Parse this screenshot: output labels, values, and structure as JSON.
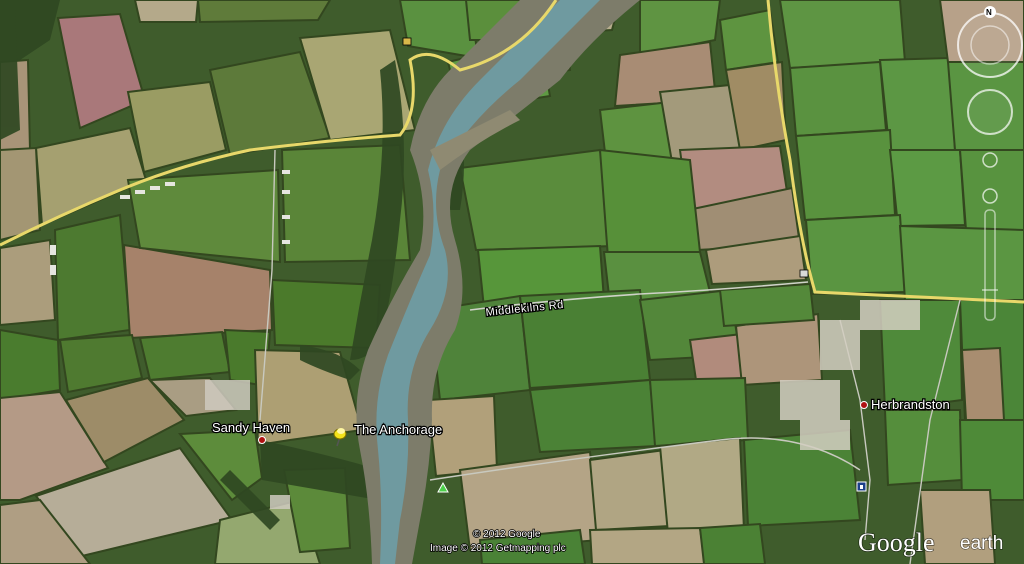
{
  "places": {
    "sandy_haven": "Sandy Haven",
    "the_anchorage": "The Anchorage",
    "herbrandston": "Herbrandston"
  },
  "roads": {
    "middle_rd": "Middlekilns Rd"
  },
  "credits": {
    "line1": "© 2012 Google",
    "line2": "Image © 2012 Getmapping plc"
  },
  "branding": {
    "google": "Google",
    "earth": "earth"
  },
  "compass": {
    "north": "N"
  },
  "colors": {
    "road": "#e8d86a",
    "marker": "#b01212",
    "pushpin": "#f3e21a",
    "water": "#6f9aa0"
  },
  "icons": [
    "navigation-compass-icon",
    "look-joystick-icon",
    "zoom-slider-icon",
    "pushpin-icon",
    "place-marker-icon",
    "info-marker-icon",
    "campsite-icon"
  ]
}
